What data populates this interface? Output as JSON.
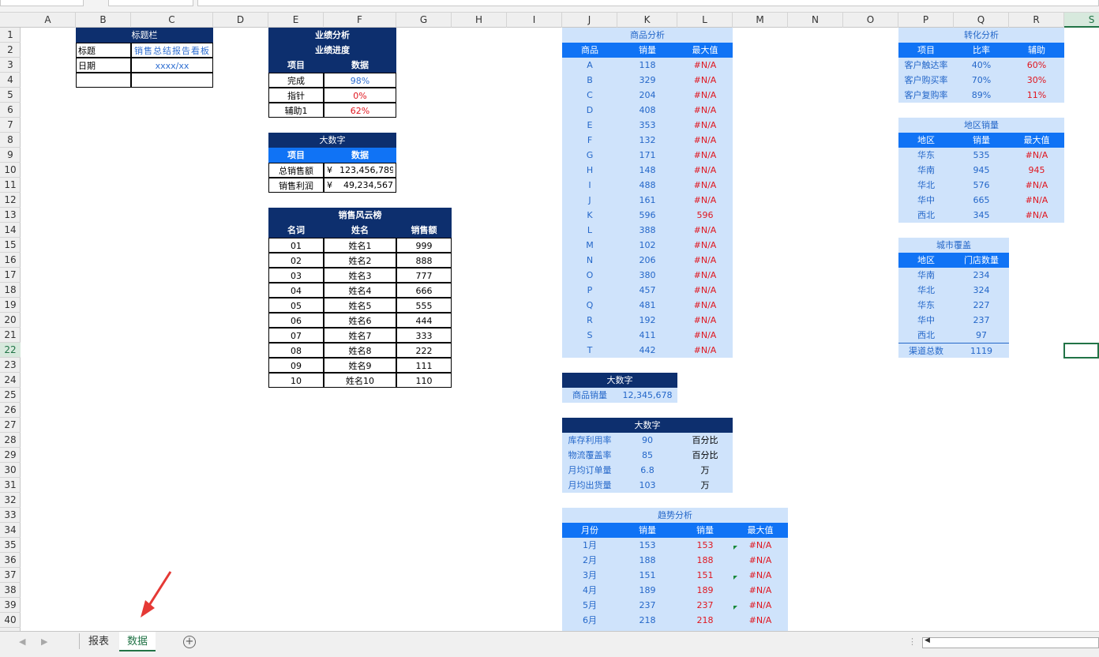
{
  "columns": [
    "A",
    "B",
    "C",
    "D",
    "E",
    "F",
    "G",
    "H",
    "I",
    "J",
    "K",
    "L",
    "M",
    "N",
    "O",
    "P",
    "Q",
    "R",
    "S"
  ],
  "rows": [
    "1",
    "2",
    "3",
    "4",
    "5",
    "6",
    "7",
    "8",
    "9",
    "10",
    "11",
    "12",
    "13",
    "14",
    "15",
    "16",
    "17",
    "18",
    "19",
    "20",
    "21",
    "22",
    "23",
    "24",
    "25",
    "26",
    "27",
    "28",
    "29",
    "30",
    "31",
    "32",
    "33",
    "34",
    "35",
    "36",
    "37",
    "38",
    "39",
    "40"
  ],
  "title_block": {
    "header": "标题栏",
    "r1_label": "标题",
    "r1_value": "销售总结报告看板",
    "r2_label": "日期",
    "r2_value": "xxxx/xx"
  },
  "perf": {
    "title": "业绩分析",
    "subtitle": "业绩进度",
    "h1": "项目",
    "h2": "数据",
    "rows": [
      {
        "k": "完成",
        "v": "98%"
      },
      {
        "k": "指针",
        "v": "0%"
      },
      {
        "k": "辅助1",
        "v": "62%"
      }
    ]
  },
  "bignum1": {
    "title": "大数字",
    "h1": "项目",
    "h2": "数据",
    "rows": [
      {
        "k": "总销售额",
        "cur": "¥",
        "v": "123,456,789"
      },
      {
        "k": "销售利润",
        "cur": "¥",
        "v": "49,234,567"
      }
    ]
  },
  "rank": {
    "title": "销售风云榜",
    "h1": "名词",
    "h2": "姓名",
    "h3": "销售额",
    "rows": [
      [
        "01",
        "姓名1",
        "999"
      ],
      [
        "02",
        "姓名2",
        "888"
      ],
      [
        "03",
        "姓名3",
        "777"
      ],
      [
        "04",
        "姓名4",
        "666"
      ],
      [
        "05",
        "姓名5",
        "555"
      ],
      [
        "06",
        "姓名6",
        "444"
      ],
      [
        "07",
        "姓名7",
        "333"
      ],
      [
        "08",
        "姓名8",
        "222"
      ],
      [
        "09",
        "姓名9",
        "111"
      ],
      [
        "10",
        "姓名10",
        "110"
      ]
    ]
  },
  "product": {
    "title": "商品分析",
    "h1": "商品",
    "h2": "销量",
    "h3": "最大值",
    "rows": [
      [
        "A",
        "118",
        "#N/A"
      ],
      [
        "B",
        "329",
        "#N/A"
      ],
      [
        "C",
        "204",
        "#N/A"
      ],
      [
        "D",
        "408",
        "#N/A"
      ],
      [
        "E",
        "353",
        "#N/A"
      ],
      [
        "F",
        "132",
        "#N/A"
      ],
      [
        "G",
        "171",
        "#N/A"
      ],
      [
        "H",
        "148",
        "#N/A"
      ],
      [
        "I",
        "488",
        "#N/A"
      ],
      [
        "J",
        "161",
        "#N/A"
      ],
      [
        "K",
        "596",
        "596"
      ],
      [
        "L",
        "388",
        "#N/A"
      ],
      [
        "M",
        "102",
        "#N/A"
      ],
      [
        "N",
        "206",
        "#N/A"
      ],
      [
        "O",
        "380",
        "#N/A"
      ],
      [
        "P",
        "457",
        "#N/A"
      ],
      [
        "Q",
        "481",
        "#N/A"
      ],
      [
        "R",
        "192",
        "#N/A"
      ],
      [
        "S",
        "411",
        "#N/A"
      ],
      [
        "T",
        "442",
        "#N/A"
      ]
    ]
  },
  "bignum2": {
    "title": "大数字",
    "k": "商品销量",
    "v": "12,345,678"
  },
  "bignum3": {
    "title": "大数字",
    "rows": [
      [
        "库存利用率",
        "90",
        "百分比"
      ],
      [
        "物流覆盖率",
        "85",
        "百分比"
      ],
      [
        "月均订单量",
        "6.8",
        "万"
      ],
      [
        "月均出货量",
        "103",
        "万"
      ]
    ]
  },
  "trend": {
    "title": "趋势分析",
    "h1": "月份",
    "h2": "销量",
    "h3": "销量",
    "h4": "最大值",
    "rows": [
      [
        "1月",
        "153",
        "153",
        "#N/A"
      ],
      [
        "2月",
        "188",
        "188",
        "#N/A"
      ],
      [
        "3月",
        "151",
        "151",
        "#N/A"
      ],
      [
        "4月",
        "189",
        "189",
        "#N/A"
      ],
      [
        "5月",
        "237",
        "237",
        "#N/A"
      ],
      [
        "6月",
        "218",
        "218",
        "#N/A"
      ]
    ]
  },
  "convert": {
    "title": "转化分析",
    "h1": "项目",
    "h2": "比率",
    "h3": "辅助",
    "rows": [
      [
        "客户触达率",
        "40%",
        "60%"
      ],
      [
        "客户购买率",
        "70%",
        "30%"
      ],
      [
        "客户复购率",
        "89%",
        "11%"
      ]
    ]
  },
  "region": {
    "title": "地区销量",
    "h1": "地区",
    "h2": "销量",
    "h3": "最大值",
    "rows": [
      [
        "华东",
        "535",
        "#N/A"
      ],
      [
        "华南",
        "945",
        "945"
      ],
      [
        "华北",
        "576",
        "#N/A"
      ],
      [
        "华中",
        "665",
        "#N/A"
      ],
      [
        "西北",
        "345",
        "#N/A"
      ]
    ]
  },
  "city": {
    "title": "城市覆盖",
    "h1": "地区",
    "h2": "门店数量",
    "rows": [
      [
        "华南",
        "234"
      ],
      [
        "华北",
        "324"
      ],
      [
        "华东",
        "227"
      ],
      [
        "华中",
        "237"
      ],
      [
        "西北",
        "97"
      ]
    ],
    "total_k": "渠道总数",
    "total_v": "1119"
  },
  "sheets": {
    "tab1": "报表",
    "tab2": "数据",
    "add": "+"
  },
  "colors": {
    "dark": "#0d2f6e",
    "blue": "#1073f5",
    "light": "#cfe3fb",
    "red": "#e0161f",
    "excel_green": "#217346"
  }
}
